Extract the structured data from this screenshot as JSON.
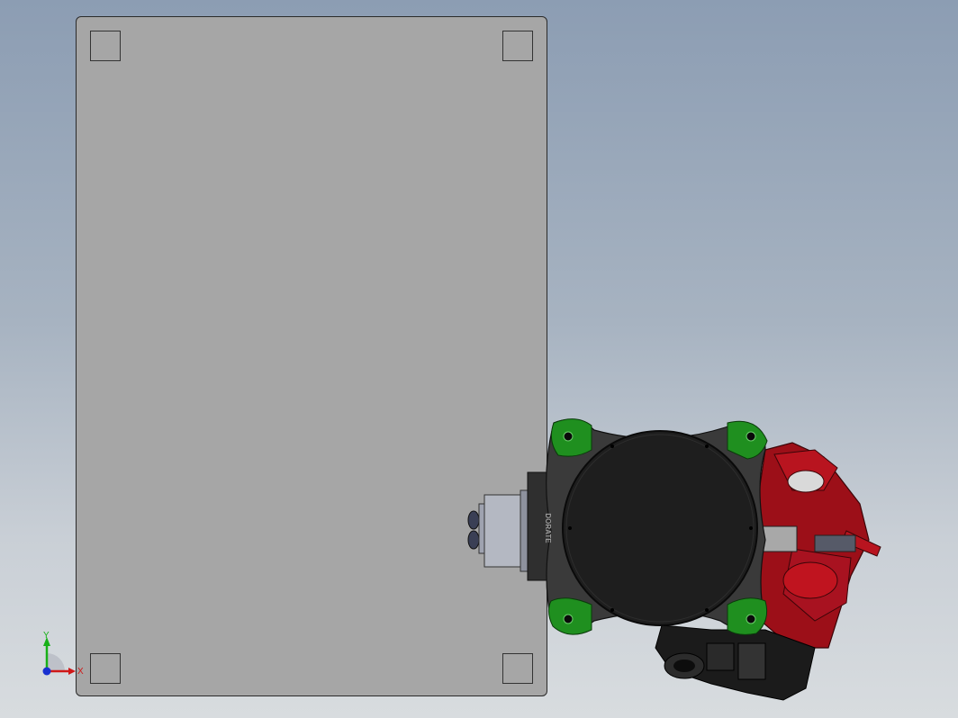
{
  "viewport": {
    "background_top": "#8c9db3",
    "background_bottom": "#d8dcdf"
  },
  "model": {
    "plate_color": "#a6a6a6",
    "base_color": "#3a3a3a",
    "disk_color": "#1e1e1e",
    "corner_pad_color": "#1f8f1f",
    "arm_color": "#a0101a",
    "motor_color": "#b4b8c2",
    "brand_text": "DORATE"
  },
  "triad": {
    "y_label": "Y",
    "x_label": "X",
    "x_color": "#d01818",
    "y_color": "#18b018",
    "z_color": "#1830d0"
  }
}
